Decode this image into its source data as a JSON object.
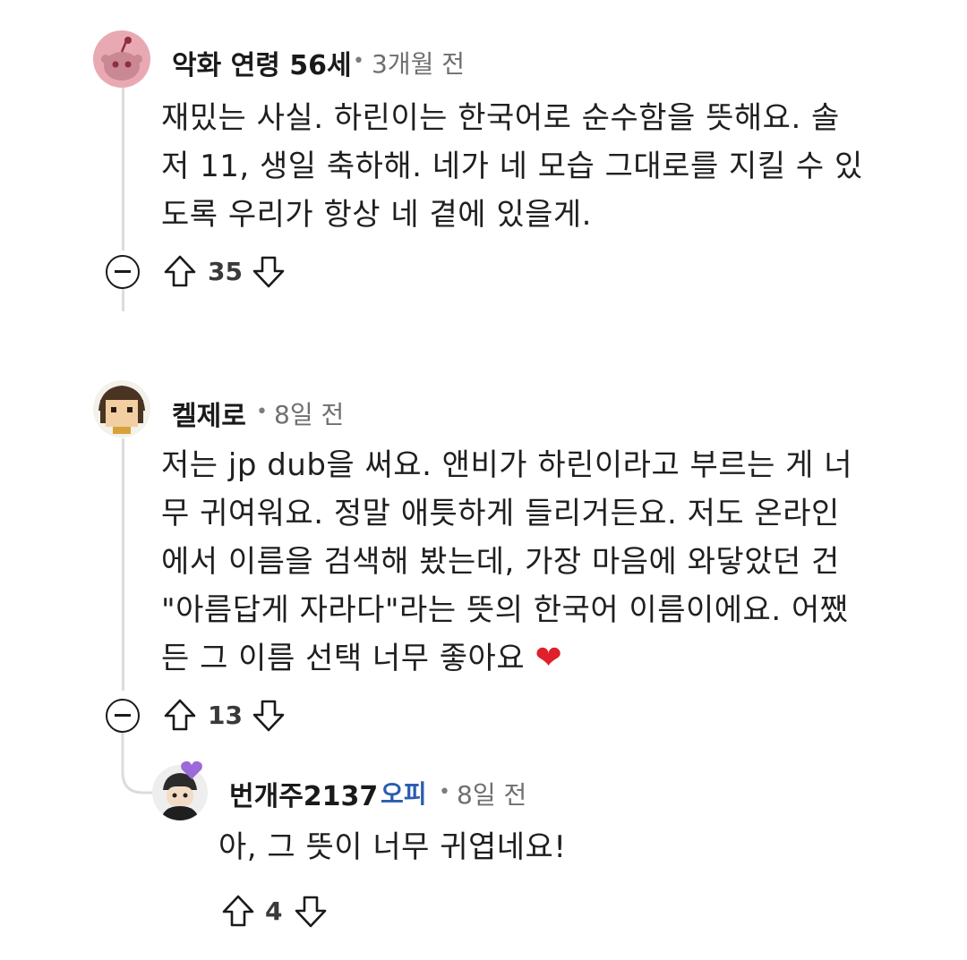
{
  "comments": [
    {
      "username": "악화 연령 56세",
      "time": "3개월 전",
      "lines": [
        "재밌는 사실. 하린이는 한국어로 순수함을 뜻해요. 솔",
        "저 11, 생일 축하해. 네가 네 모습 그대로를 지킬 수 있",
        "도록 우리가 항상 네 곁에 있을게."
      ],
      "score": "35",
      "avatar_icon": "reddit-snoo-avatar"
    },
    {
      "username": "켈제로",
      "time": "8일 전",
      "lines": [
        "저는 jp dub을 써요. 앤비가 하린이라고 부르는 게 너",
        "무 귀여워요. 정말 애틋하게 들리거든요. 저도 온라인",
        "에서 이름을 검색해 봤는데, 가장 마음에 와닿았던 건",
        "\"아름답게 자라다\"라는 뜻의 한국어 이름이에요. 어쨌",
        "든 그 이름 선택 너무 좋아요"
      ],
      "emoji": "❤",
      "score": "13",
      "avatar_icon": "pixel-character-avatar"
    },
    {
      "username": "번개주2137",
      "badge": "오피",
      "time": "8일 전",
      "lines": [
        "아, 그 뜻이 너무 귀엽네요!"
      ],
      "score": "4",
      "avatar_icon": "anime-character-avatar"
    }
  ],
  "separator": "•",
  "colors": {
    "heart": "#e0202a",
    "op_badge": "#2a5db0",
    "thread_line": "#dcdcdc"
  }
}
